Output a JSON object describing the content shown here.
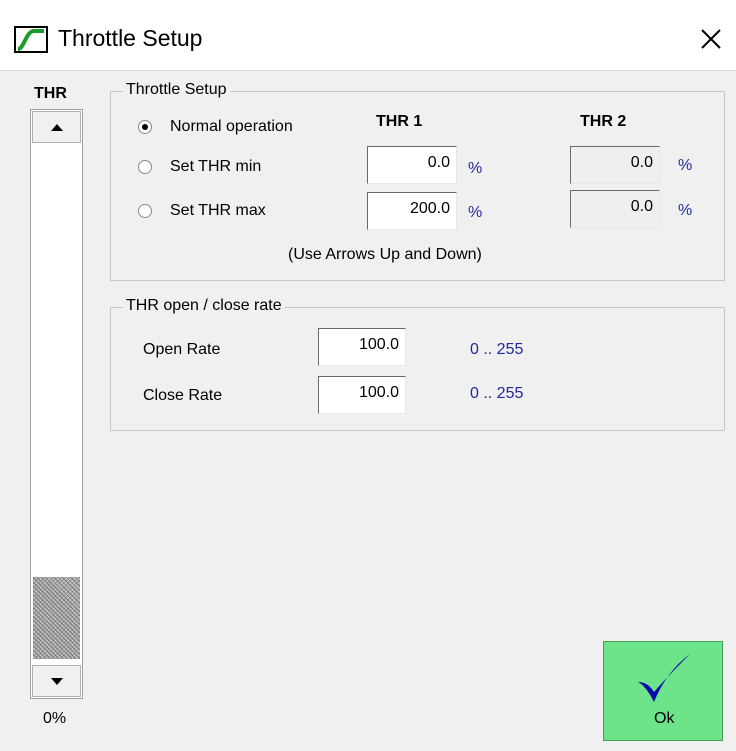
{
  "window": {
    "title": "Throttle Setup",
    "icon": "throttle-curve-icon",
    "close_icon": "close-icon"
  },
  "slider": {
    "label": "THR",
    "value_text": "0%",
    "level_fraction": 0.0
  },
  "throttle_setup": {
    "group_title": "Throttle Setup",
    "col_thr1": "THR 1",
    "col_thr2": "THR 2",
    "options": [
      {
        "label": "Normal operation",
        "selected": true
      },
      {
        "label": "Set THR min",
        "selected": false
      },
      {
        "label": "Set THR max",
        "selected": false
      }
    ],
    "thr1": {
      "min": "0.0",
      "max": "200.0",
      "unit": "%"
    },
    "thr2": {
      "min": "0.0",
      "max": "0.0",
      "unit": "%"
    },
    "hint": "(Use Arrows Up and Down)"
  },
  "rates": {
    "group_title": "THR open / close rate",
    "open": {
      "label": "Open Rate",
      "value": "100.0",
      "range": "0 .. 255"
    },
    "close": {
      "label": "Close Rate",
      "value": "100.0",
      "range": "0 .. 255"
    }
  },
  "ok_button": {
    "label": "Ok",
    "icon": "checkmark-icon"
  },
  "colors": {
    "accent_blue": "#1f2a9a",
    "ok_green": "#6ee48a"
  }
}
